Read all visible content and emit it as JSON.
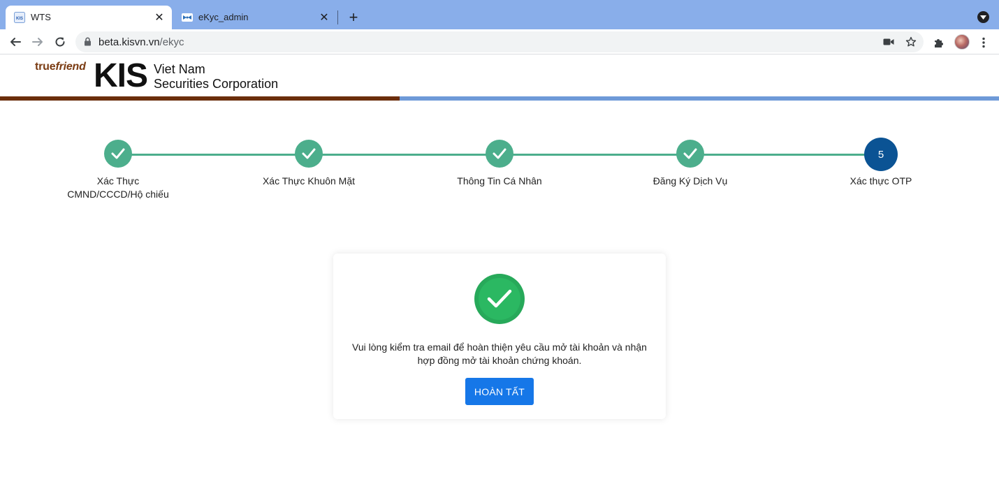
{
  "browser": {
    "tabs": [
      {
        "title": "WTS",
        "active": true,
        "favicon": "kis-favicon-icon"
      },
      {
        "title": "eKyc_admin",
        "active": false,
        "favicon": "bow-favicon-icon"
      }
    ],
    "new_tab_label": "+",
    "url": {
      "host": "beta.kisvn.vn",
      "path": "/ekyc"
    },
    "icons": [
      "back-arrow-icon",
      "forward-arrow-icon",
      "reload-icon",
      "lock-icon",
      "camera-icon",
      "star-icon",
      "extensions-puzzle-icon",
      "profile-avatar",
      "kebab-menu-icon",
      "tab-search-icon"
    ]
  },
  "header": {
    "brand_true": "true",
    "brand_friend": "friend",
    "logo_text": "KIS",
    "company_line1": "Viet Nam",
    "company_line2": "Securities Corporation",
    "colors": {
      "brown": "#6b2e0c",
      "blue": "#6e9ad8"
    }
  },
  "stepper": {
    "steps": [
      {
        "label": "Xác Thực\nCMND/CCCD/Hộ chiếu",
        "status": "done"
      },
      {
        "label": "Xác Thực Khuôn Mặt",
        "status": "done"
      },
      {
        "label": "Thông Tin Cá Nhân",
        "status": "done"
      },
      {
        "label": "Đăng Ký Dịch Vụ",
        "status": "done"
      },
      {
        "label": "Xác thực OTP",
        "status": "current",
        "number": "5"
      }
    ],
    "colors": {
      "done": "#4cae8c",
      "current": "#0b5394"
    }
  },
  "result_card": {
    "icon": "success-check-icon",
    "message": "Vui lòng kiểm tra email để hoàn thiện yêu cầu mở tài khoản và nhận hợp đồng mở tài khoản chứng khoán.",
    "button_label": "HOÀN TẤT",
    "colors": {
      "success": "#27a95a",
      "button": "#1677e8"
    }
  }
}
